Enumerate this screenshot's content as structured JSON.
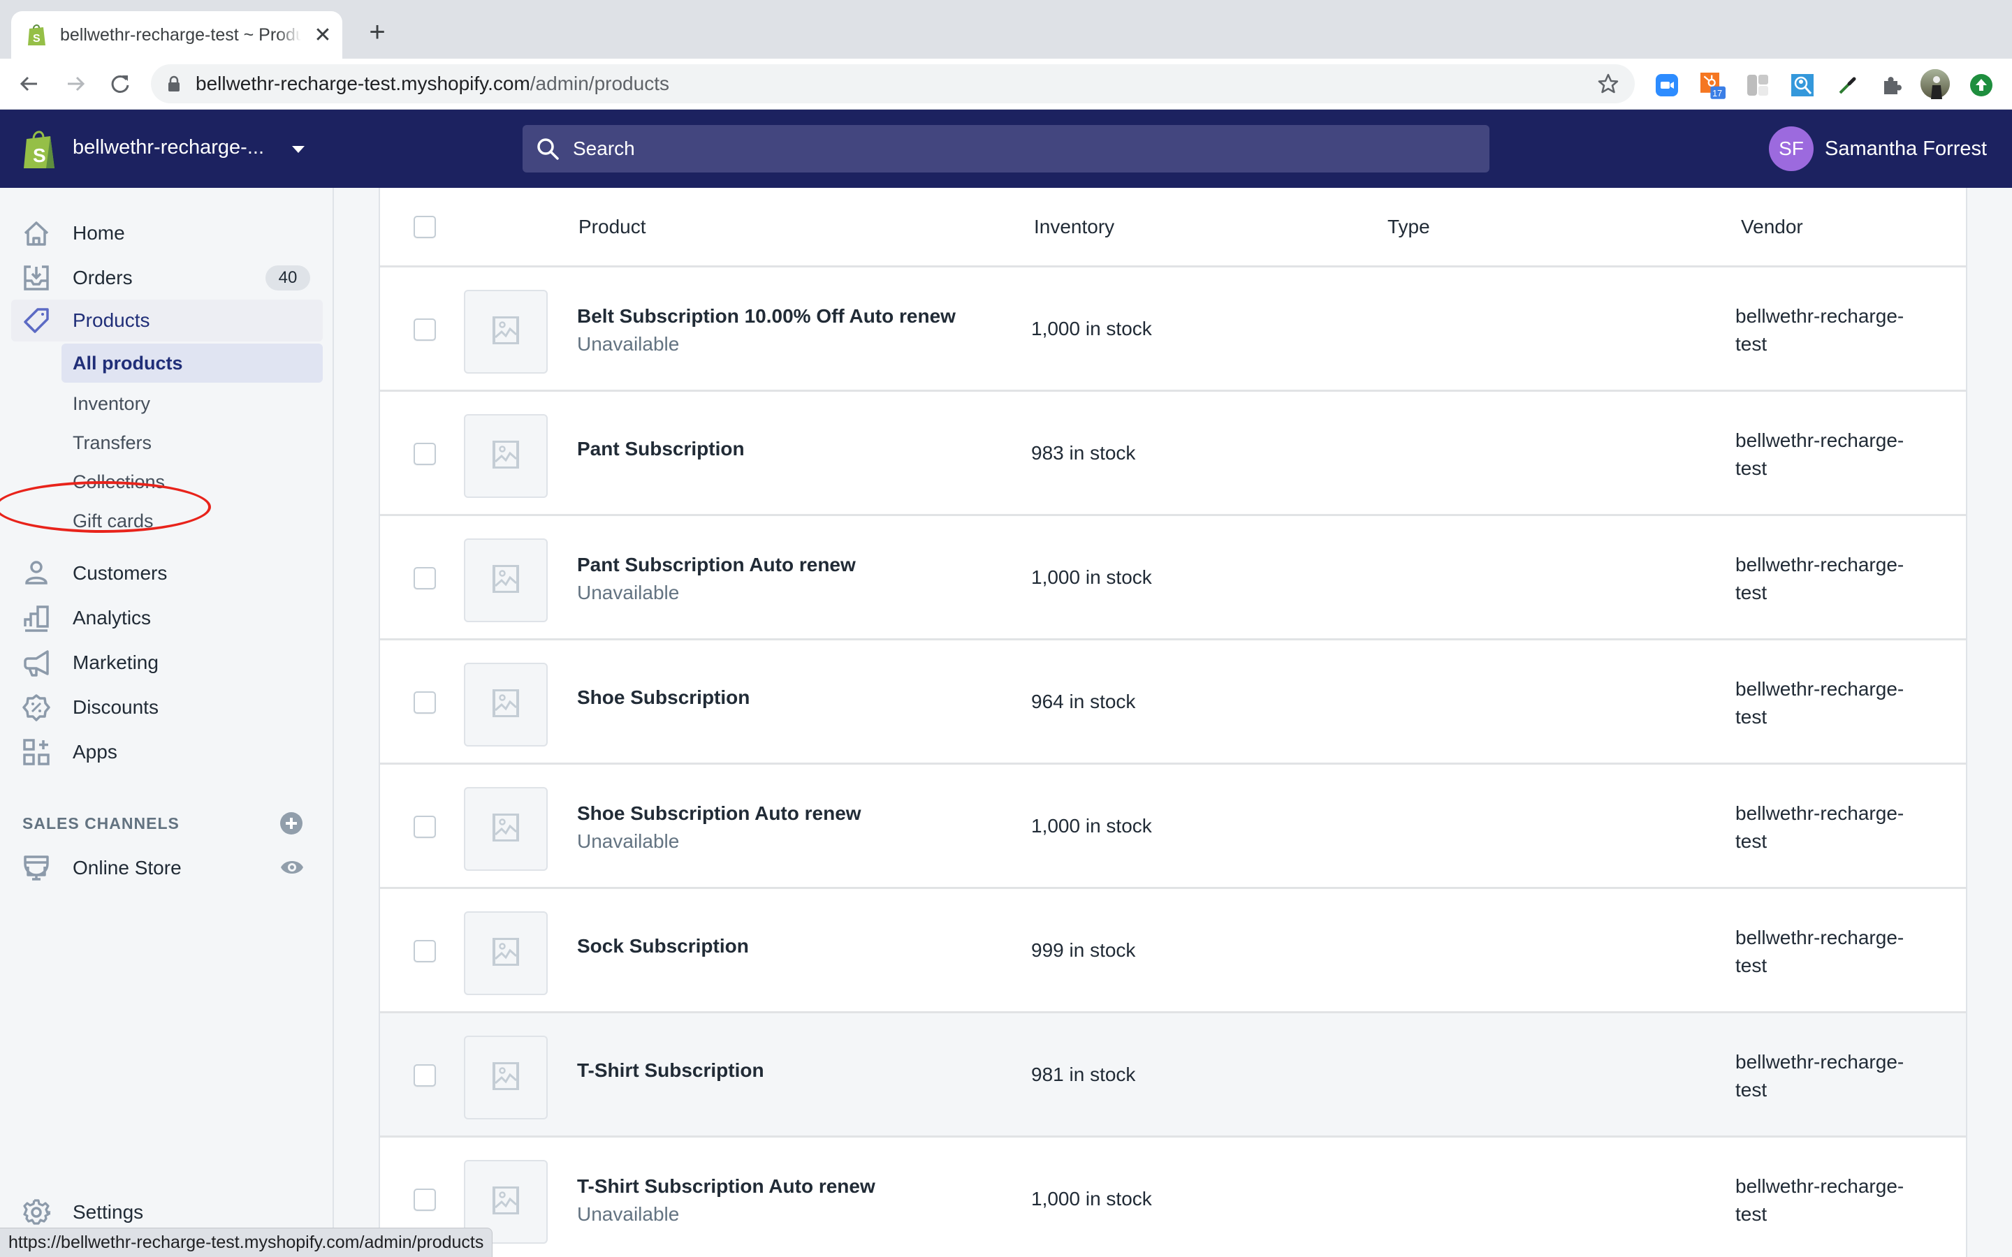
{
  "browser": {
    "tab_title": "bellwethr-recharge-test ~ Products ~ Shopify",
    "url_host": "bellwethr-recharge-test.myshopify.com",
    "url_path": "/admin/products",
    "extension_badge": "17",
    "status_url": "https://bellwethr-recharge-test.myshopify.com/admin/products"
  },
  "topbar": {
    "store_name": "bellwethr-recharge-...",
    "search_placeholder": "Search",
    "user_initials": "SF",
    "user_name": "Samantha Forrest"
  },
  "sidebar": {
    "items": [
      {
        "label": "Home",
        "icon": "home-icon"
      },
      {
        "label": "Orders",
        "icon": "orders-icon",
        "badge": "40"
      },
      {
        "label": "Products",
        "icon": "tag-icon",
        "active": true
      },
      {
        "label": "Customers",
        "icon": "customer-icon"
      },
      {
        "label": "Analytics",
        "icon": "analytics-icon"
      },
      {
        "label": "Marketing",
        "icon": "megaphone-icon"
      },
      {
        "label": "Discounts",
        "icon": "discount-icon"
      },
      {
        "label": "Apps",
        "icon": "apps-icon"
      }
    ],
    "product_subitems": [
      {
        "label": "All products",
        "active": true
      },
      {
        "label": "Inventory"
      },
      {
        "label": "Transfers"
      },
      {
        "label": "Collections"
      },
      {
        "label": "Gift cards"
      }
    ],
    "sales_channels_heading": "SALES CHANNELS",
    "online_store_label": "Online Store",
    "settings_label": "Settings"
  },
  "table": {
    "columns": [
      "Product",
      "Inventory",
      "Type",
      "Vendor"
    ],
    "rows": [
      {
        "name": "Belt Subscription 10.00% Off Auto renew",
        "status": "Unavailable",
        "inventory": "1,000 in stock",
        "type": "",
        "vendor_line1": "bellwethr-recharge-",
        "vendor_line2": "test"
      },
      {
        "name": "Pant Subscription",
        "status": "",
        "inventory": "983 in stock",
        "type": "",
        "vendor_line1": "bellwethr-recharge-",
        "vendor_line2": "test"
      },
      {
        "name": "Pant Subscription Auto renew",
        "status": "Unavailable",
        "inventory": "1,000 in stock",
        "type": "",
        "vendor_line1": "bellwethr-recharge-",
        "vendor_line2": "test"
      },
      {
        "name": "Shoe Subscription",
        "status": "",
        "inventory": "964 in stock",
        "type": "",
        "vendor_line1": "bellwethr-recharge-",
        "vendor_line2": "test"
      },
      {
        "name": "Shoe Subscription Auto renew",
        "status": "Unavailable",
        "inventory": "1,000 in stock",
        "type": "",
        "vendor_line1": "bellwethr-recharge-",
        "vendor_line2": "test"
      },
      {
        "name": "Sock Subscription",
        "status": "",
        "inventory": "999 in stock",
        "type": "",
        "vendor_line1": "bellwethr-recharge-",
        "vendor_line2": "test"
      },
      {
        "name": "T-Shirt Subscription",
        "status": "",
        "inventory": "981 in stock",
        "type": "",
        "vendor_line1": "bellwethr-recharge-",
        "vendor_line2": "test"
      },
      {
        "name": "T-Shirt Subscription Auto renew",
        "status": "Unavailable",
        "inventory": "1,000 in stock",
        "type": "",
        "vendor_line1": "bellwethr-recharge-",
        "vendor_line2": "test"
      }
    ]
  },
  "colors": {
    "topbar_bg": "#1c2260",
    "search_bg": "#43467f",
    "avatar_bg": "#9c6ade",
    "active_nav_text": "#202e78",
    "annotation_red": "#e8231b",
    "shopify_green": "#95bf47"
  }
}
